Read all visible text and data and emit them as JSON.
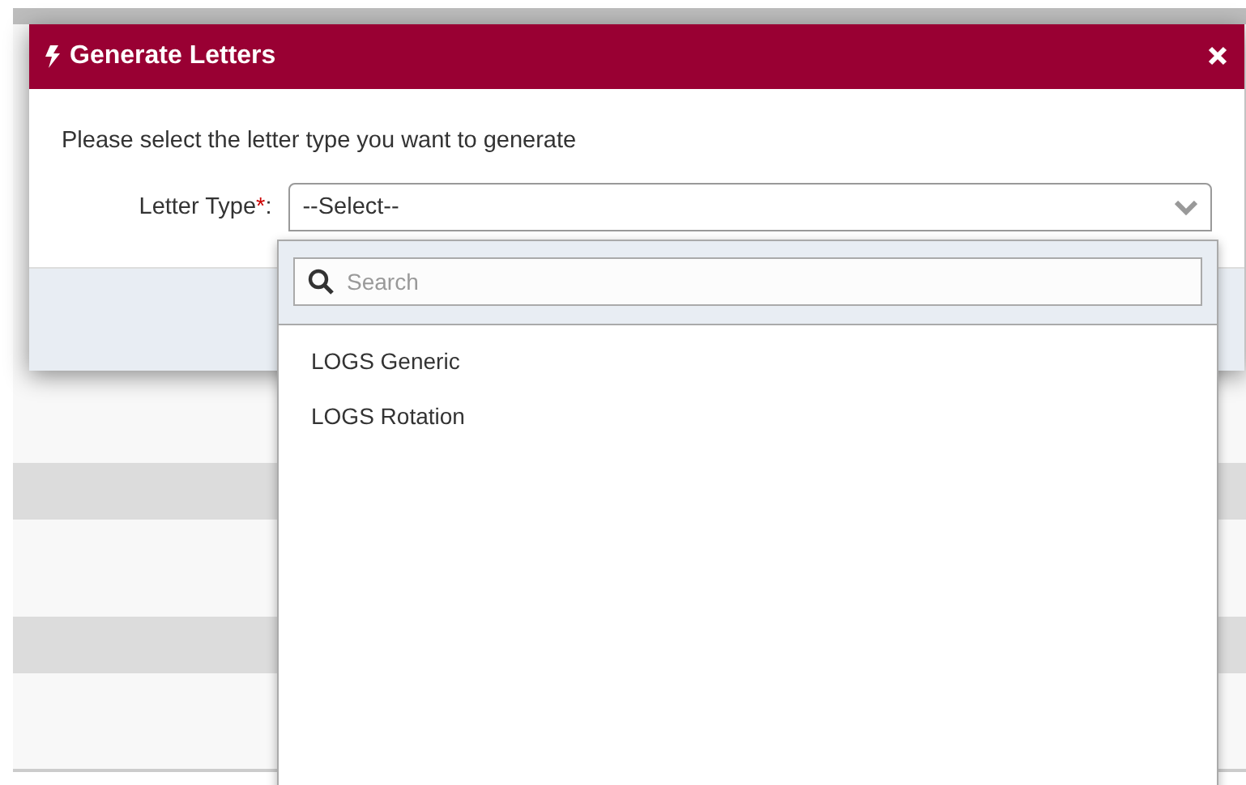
{
  "dialog": {
    "title": "Generate Letters",
    "prompt": "Please select the letter type you want to generate",
    "field": {
      "label": "Letter Type",
      "required_mark": "*",
      "suffix": ":",
      "value": "--Select--",
      "expanded": true
    }
  },
  "dropdown": {
    "search": {
      "placeholder": "Search"
    },
    "options": [
      {
        "label": "LOGS Generic",
        "selected": false
      },
      {
        "label": "LOGS Rotation",
        "selected": false
      }
    ]
  }
}
